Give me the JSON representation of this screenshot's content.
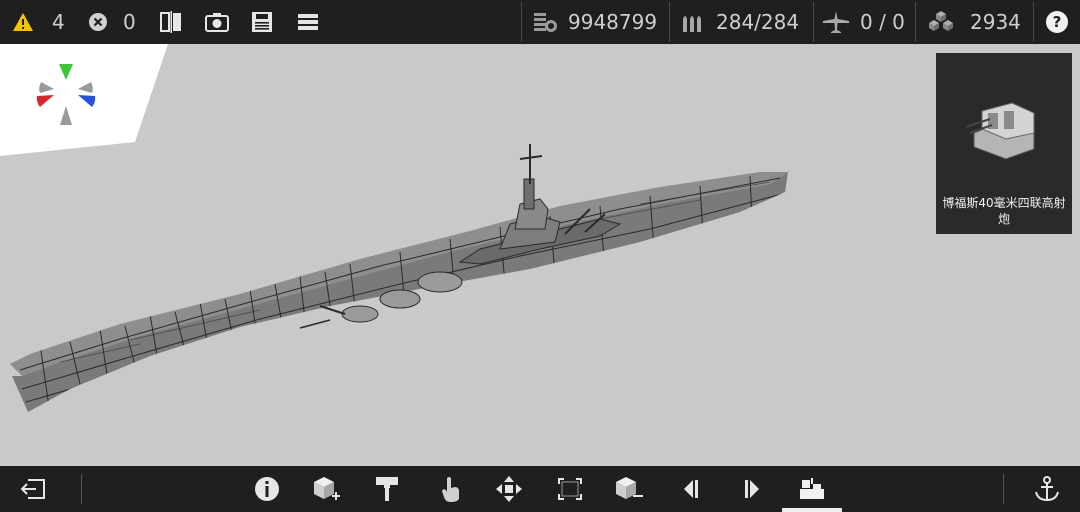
{
  "top_bar": {
    "warnings_count": "4",
    "errors_count": "0",
    "funds": "9948799",
    "ammo": "284/284",
    "aircraft": "0 / 0",
    "blocks": "2934",
    "help_label": "?"
  },
  "part_preview": {
    "label": "博福斯40毫米四联高射炮"
  },
  "colors": {
    "warning": "#f5c400",
    "toolbar_bg": "#1f1f1f",
    "viewport_bg": "#c9c9c9",
    "gizmo_green": "#3cc43c",
    "gizmo_red": "#d42a2a",
    "gizmo_blue": "#2452d8"
  },
  "icons": {
    "top": [
      "warning-icon",
      "error-icon",
      "mirror-icon",
      "screenshot-icon",
      "save-icon",
      "menu-icon",
      "funds-icon",
      "ammo-icon",
      "aircraft-icon",
      "blocks-icon",
      "help-icon"
    ],
    "bottom": [
      "exit-icon",
      "info-icon",
      "add-part-icon",
      "paint-icon",
      "touch-select-icon",
      "move-icon",
      "transform-icon",
      "remove-part-icon",
      "previous-icon",
      "next-icon",
      "part-catalog-icon",
      "anchor-icon"
    ]
  }
}
